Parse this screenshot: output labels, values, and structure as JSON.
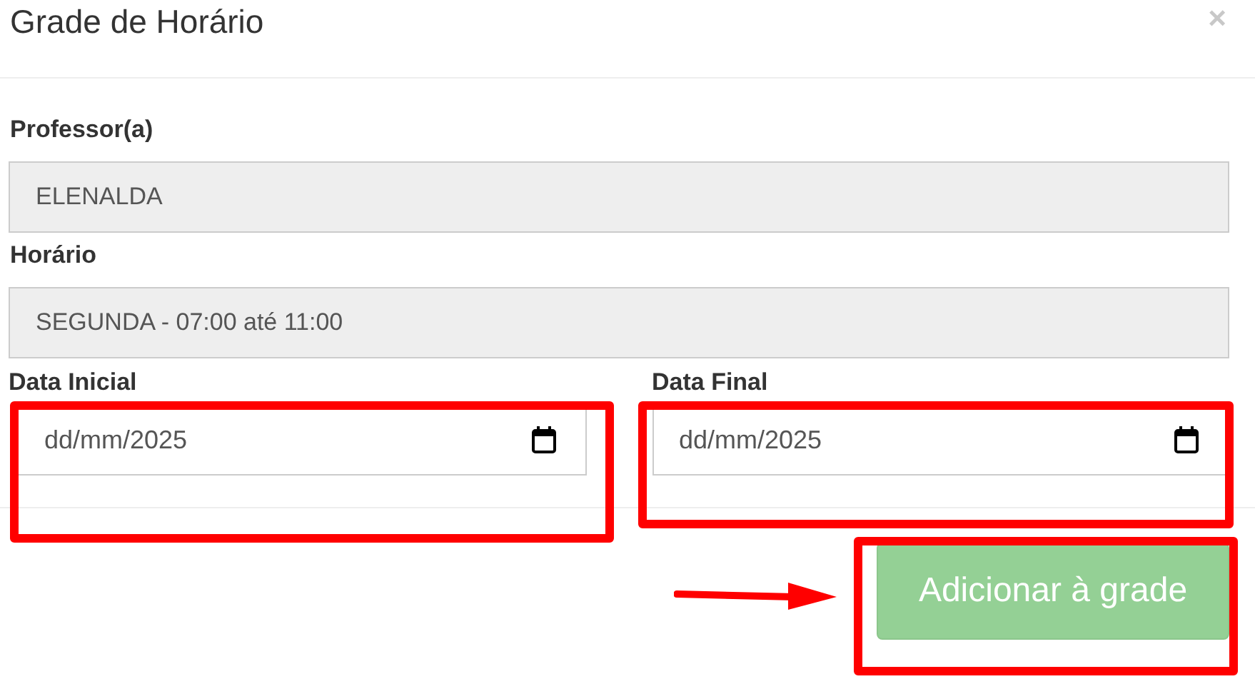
{
  "modal": {
    "title": "Grade de Horário",
    "close": "×"
  },
  "fields": [
    {
      "label": "Professor(a)",
      "value": "ELENALDA",
      "disabled": true
    },
    {
      "label": "Horário",
      "value": "SEGUNDA - 07:00 até 11:00",
      "disabled": true
    }
  ],
  "date_fields": [
    {
      "label": "Data Inicial",
      "value": "dd/mm/2025",
      "highlighted": true
    },
    {
      "label": "Data Final",
      "value": "dd/mm/2025",
      "highlighted": true
    }
  ],
  "submit_button": {
    "label": "Adicionar à grade",
    "disabled": true,
    "highlighted": true
  }
}
